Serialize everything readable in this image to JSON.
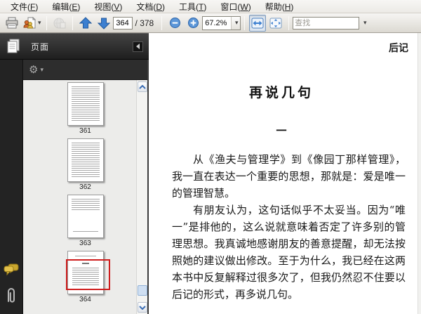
{
  "menu_bar": {
    "items": [
      {
        "label": "文件",
        "mnemonic": "F"
      },
      {
        "label": "编辑",
        "mnemonic": "E"
      },
      {
        "label": "视图",
        "mnemonic": "V"
      },
      {
        "label": "文档",
        "mnemonic": "D"
      },
      {
        "label": "工具",
        "mnemonic": "T"
      },
      {
        "label": "窗口",
        "mnemonic": "W"
      },
      {
        "label": "帮助",
        "mnemonic": "H"
      }
    ]
  },
  "toolbar": {
    "page_value": "364",
    "page_total_label": "/ 378",
    "zoom_level": "67.2%",
    "find_placeholder": "查找",
    "icons": {
      "gear": "⚙",
      "caret_down": "▾"
    },
    "colors": {
      "accent_blue": "#3c7fd0",
      "pressed_bg": "#dde6f1",
      "selection_red": "#cf1d1d"
    }
  },
  "sidebar": {
    "panel_title": "页面",
    "thumbnails": [
      {
        "page": "361",
        "style": "dense",
        "selected": false
      },
      {
        "page": "362",
        "style": "dense",
        "selected": false
      },
      {
        "page": "363",
        "style": "sparse",
        "selected": false
      },
      {
        "page": "364",
        "style": "title",
        "selected": true
      }
    ]
  },
  "document": {
    "header_right": "后记",
    "title": "再说几句",
    "section_marker": "一",
    "paragraphs": [
      [
        "从《渔夫与管理学》到《像园丁那样管理》，",
        "我一直在表达一个重要的思想，那就是：爱是唯一",
        "的管理智慧。"
      ],
      [
        "有朋友认为，这句话似乎不太妥当。因为“唯",
        "一”是排他的，这么说就意味着否定了许多别的管",
        "理思想。我真诚地感谢朋友的善意提醒，却无法按",
        "照她的建议做出修改。至于为什么，我已经在这两",
        "本书中反复解释过很多次了，但我仍然忍不住要以",
        "后记的形式，再多说几句。"
      ]
    ]
  }
}
